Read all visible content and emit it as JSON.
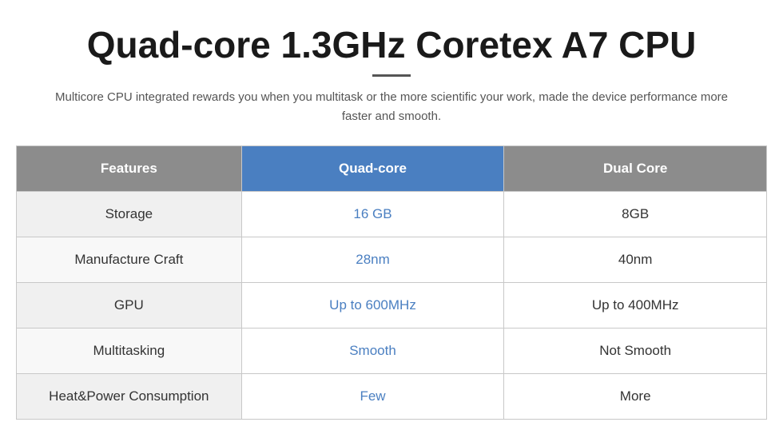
{
  "page": {
    "title": "Quad-core 1.3GHz Coretex A7 CPU",
    "subtitle": "Multicore CPU integrated rewards you when you multitask or the more scientific your work, made the device performance more faster and smooth.",
    "divider": true
  },
  "table": {
    "headers": {
      "features": "Features",
      "quadcore": "Quad-core",
      "dualcore": "Dual Core"
    },
    "rows": [
      {
        "feature": "Storage",
        "quadcore_value": "16 GB",
        "dualcore_value": "8GB"
      },
      {
        "feature": "Manufacture Craft",
        "quadcore_value": "28nm",
        "dualcore_value": "40nm"
      },
      {
        "feature": "GPU",
        "quadcore_value": "Up to 600MHz",
        "dualcore_value": "Up to 400MHz"
      },
      {
        "feature": "Multitasking",
        "quadcore_value": "Smooth",
        "dualcore_value": "Not Smooth"
      },
      {
        "feature": "Heat&Power Consumption",
        "quadcore_value": "Few",
        "dualcore_value": "More"
      }
    ]
  }
}
